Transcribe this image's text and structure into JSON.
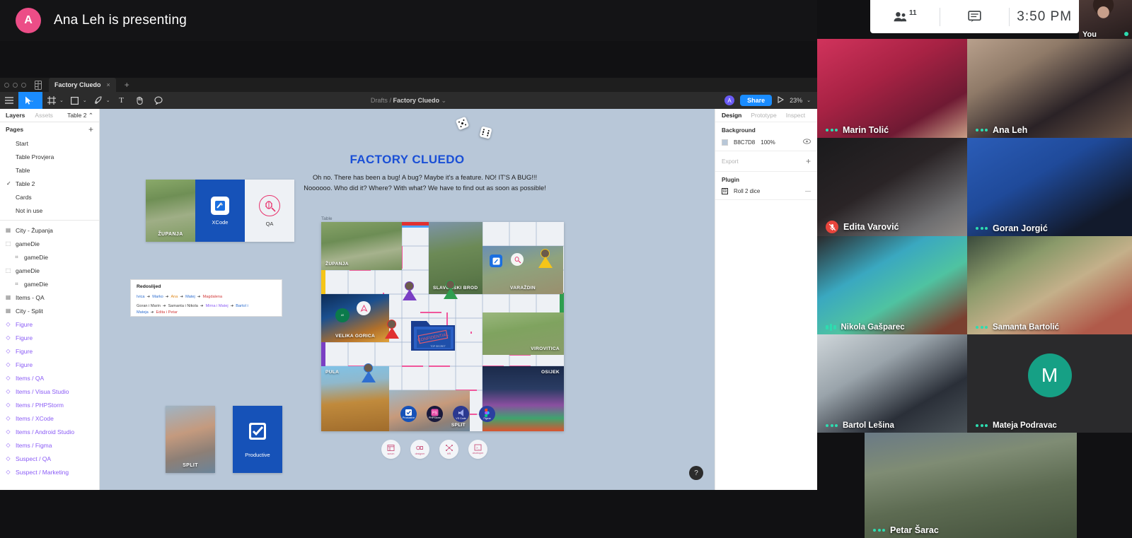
{
  "presenting": {
    "avatar_initial": "A",
    "text": "Ana Leh is presenting"
  },
  "meet_controls": {
    "people_icon": "people-icon",
    "participant_count": "11",
    "chat_icon": "chat-icon",
    "time": "3:50 PM"
  },
  "self_view": {
    "label": "You"
  },
  "figma": {
    "window_tab": {
      "title": "Factory Cluedo",
      "close": "×",
      "new_tab": "+"
    },
    "toolbar": {
      "menu_icon": "hamburger-menu-icon",
      "move_tool": "cursor-move-icon",
      "frame_tool": "frame-icon",
      "shape_tool": "square-shape-icon",
      "pen_tool": "pen-icon",
      "text_tool": "T",
      "hand_tool": "hand-icon",
      "comment_tool": "comment-icon",
      "caret": "⌄"
    },
    "breadcrumb": {
      "parent": "Drafts",
      "separator": "/",
      "file": "Factory Cluedo",
      "caret": "⌄"
    },
    "header_right": {
      "user_initial": "A",
      "share_label": "Share",
      "present_icon": "play-present-icon",
      "zoom": "23%",
      "zoom_caret": "⌄"
    },
    "left_panel": {
      "tabs": [
        {
          "label": "Layers",
          "active": true
        },
        {
          "label": "Assets",
          "active": false
        }
      ],
      "current_page": "Table 2",
      "current_page_caret": "⌃",
      "pages_header": "Pages",
      "add_page": "+",
      "pages": [
        {
          "label": "Start",
          "selected": false
        },
        {
          "label": "Table Provjera",
          "selected": false
        },
        {
          "label": "Table",
          "selected": false
        },
        {
          "label": "Table 2",
          "selected": true
        },
        {
          "label": "Cards",
          "selected": false
        },
        {
          "label": "Not in use",
          "selected": false
        }
      ],
      "layers": [
        {
          "label": "City - Županja",
          "type": "frame",
          "indent": 0,
          "component": false
        },
        {
          "label": "gameDie",
          "type": "group",
          "indent": 0,
          "component": false
        },
        {
          "label": "gameDie",
          "type": "component-instance",
          "indent": 1,
          "component": false
        },
        {
          "label": "gameDie",
          "type": "group",
          "indent": 0,
          "component": false
        },
        {
          "label": "gameDie",
          "type": "component-instance",
          "indent": 1,
          "component": false
        },
        {
          "label": "Items - QA",
          "type": "frame",
          "indent": 0,
          "component": false
        },
        {
          "label": "City - Split",
          "type": "frame",
          "indent": 0,
          "component": false
        },
        {
          "label": "Figure",
          "type": "instance",
          "indent": 0,
          "component": true
        },
        {
          "label": "Figure",
          "type": "instance",
          "indent": 0,
          "component": true
        },
        {
          "label": "Figure",
          "type": "instance",
          "indent": 0,
          "component": true
        },
        {
          "label": "Figure",
          "type": "instance",
          "indent": 0,
          "component": true
        },
        {
          "label": "Items / QA",
          "type": "instance",
          "indent": 0,
          "component": true
        },
        {
          "label": "Items / Visua Studio",
          "type": "instance",
          "indent": 0,
          "component": true
        },
        {
          "label": "Items / PHPStorm",
          "type": "instance",
          "indent": 0,
          "component": true
        },
        {
          "label": "Items / XCode",
          "type": "instance",
          "indent": 0,
          "component": true
        },
        {
          "label": "Items / Android Studio",
          "type": "instance",
          "indent": 0,
          "component": true
        },
        {
          "label": "Items / Figma",
          "type": "instance",
          "indent": 0,
          "component": true
        },
        {
          "label": "Suspect / QA",
          "type": "instance",
          "indent": 0,
          "component": true
        },
        {
          "label": "Suspect / Marketing",
          "type": "instance",
          "indent": 0,
          "component": true
        }
      ]
    },
    "right_panel": {
      "tabs": [
        {
          "label": "Design",
          "active": true
        },
        {
          "label": "Prototype",
          "active": false
        },
        {
          "label": "Inspect",
          "active": false
        }
      ],
      "background": {
        "title": "Background",
        "hex": "B8C7D8",
        "opacity": "100%",
        "visibility_icon": "eye-icon"
      },
      "export": {
        "title": "Export",
        "add": "+"
      },
      "plugin": {
        "title": "Plugin",
        "name": "Roll 2 dice",
        "icon": "dice-plugin-icon",
        "remove": "—"
      }
    },
    "canvas": {
      "help_button": "?",
      "board_label": "Table",
      "title": "FACTORY CLUEDO",
      "subtitle_line1": "Oh no. There has been a bug! A bug? Maybe it's a feature. NO! IT'S A BUG!!!",
      "subtitle_line2": "Noooooo. Who did it? Where? With what? We have to find out as soon as possible!",
      "top_cards": [
        {
          "label": "ŽUPANJA",
          "kind": "city"
        },
        {
          "label": "XCode",
          "kind": "tool"
        },
        {
          "label": "QA",
          "kind": "role"
        }
      ],
      "bottom_cards": [
        {
          "label": "SPLIT",
          "kind": "city"
        },
        {
          "label": "Productive",
          "kind": "tool"
        }
      ],
      "order_box": {
        "title": "Redoslijed",
        "line1": [
          {
            "text": "Ivica",
            "color": "blue"
          },
          {
            "text": "Marko",
            "color": "blue"
          },
          {
            "text": "Ana",
            "color": "orange"
          },
          {
            "text": "Matej",
            "color": "blue"
          },
          {
            "text": "Magdalena",
            "color": "red"
          }
        ],
        "line2": [
          {
            "text": "Goran i Marin",
            "color": "grey"
          },
          {
            "text": "Samanta i Nikola",
            "color": "grey"
          },
          {
            "text": "Mirna i Matej",
            "color": "purple"
          },
          {
            "text": "Bartol i Mateja",
            "color": "blue"
          },
          {
            "text": "Edita i Petar",
            "color": "red"
          }
        ],
        "arrow": "➜"
      },
      "board_tiles": [
        "ŽUPANJA",
        "SLAVONSKI BROD",
        "VARAŽDIN",
        "VELIKA GORICA",
        "VIROVITICA",
        "PULA",
        "SPLIT",
        "OSIJEK"
      ],
      "app_icons": [
        "Productive",
        "PHPStorm",
        "VS Code",
        "Figma"
      ],
      "role_icons": [
        "scrum",
        "designer",
        "HR",
        "developer"
      ],
      "dice_count": 2
    }
  },
  "participants": [
    {
      "name": "Marin Tolić",
      "status": "dots",
      "tone": "red"
    },
    {
      "name": "Ana Leh",
      "status": "dots",
      "tone": "warm"
    },
    {
      "name": "Edita Varović",
      "status": "muted",
      "tone": "dark"
    },
    {
      "name": "Goran Jorgić",
      "status": "dots",
      "tone": "blue"
    },
    {
      "name": "Nikola Gašparec",
      "status": "speaking",
      "tone": "teal"
    },
    {
      "name": "Samanta Bartolić",
      "status": "dots",
      "tone": "poster"
    },
    {
      "name": "Bartol Lešina",
      "status": "dots",
      "tone": "light"
    },
    {
      "name": "Mateja Podravac",
      "status": "dots",
      "tone": "avatar",
      "initial": "M"
    },
    {
      "name": "Petar Šarac",
      "status": "dots",
      "tone": "landscape"
    }
  ]
}
